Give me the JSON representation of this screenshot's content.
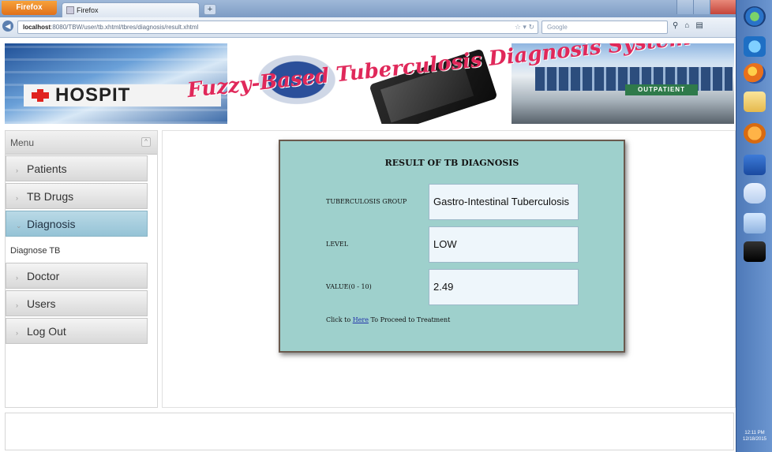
{
  "browser": {
    "app_button": "Firefox",
    "tab_title": "Firefox",
    "new_tab_symbol": "+",
    "url_host": "localhost",
    "url_path": ":8080/TBW/user/tb.xhtml/tbres/diagnosis/result.xhtml",
    "search_placeholder": "Google"
  },
  "banner": {
    "title": "Fuzzy-Based Tuberculosis Diagnosis System",
    "hospital_sign": "HOSPIT",
    "outpatient_sign": "OUTPATIENT"
  },
  "menu": {
    "header": "Menu",
    "collapse_symbol": "^",
    "items": [
      {
        "label": "Patients",
        "active": false
      },
      {
        "label": "TB Drugs",
        "active": false
      },
      {
        "label": "Diagnosis",
        "active": true
      },
      {
        "label": "Doctor",
        "active": false
      },
      {
        "label": "Users",
        "active": false
      },
      {
        "label": "Log Out",
        "active": false
      }
    ],
    "submenu_item": "Diagnose TB"
  },
  "result": {
    "title": "RESULT OF TB DIAGNOSIS",
    "fields": [
      {
        "label": "TUBERCULOSIS GROUP",
        "value": "Gastro-Intestinal Tuberculosis"
      },
      {
        "label": "LEVEL",
        "value": "LOW"
      },
      {
        "label": "VALUE(0 - 10)",
        "value": "2.49"
      }
    ],
    "click_prefix": "Click to ",
    "click_link": "Here",
    "click_suffix": " To Proceed to Treatment"
  },
  "taskbar": {
    "clock_time": "12:11 PM",
    "clock_date": "12/18/2015"
  },
  "colors": {
    "result_bg": "#9ed0cc",
    "menu_active": "#95c3d6",
    "banner_title": "#e0285a"
  }
}
